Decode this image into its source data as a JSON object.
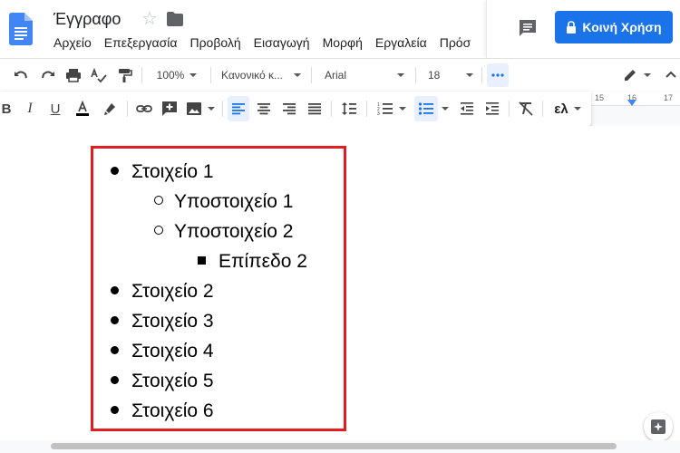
{
  "header": {
    "title": "Έγγραφο",
    "menu": [
      "Αρχείο",
      "Επεξεργασία",
      "Προβολή",
      "Εισαγωγή",
      "Μορφή",
      "Εργαλεία",
      "Πρόσ"
    ],
    "share_label": "Κοινή Χρήση"
  },
  "toolbar": {
    "zoom": "100%",
    "style": "Κανονικό κ...",
    "font": "Arial",
    "font_size": "18",
    "input_tools": "ελ"
  },
  "ruler": {
    "marks": [
      "15",
      "16",
      "17"
    ]
  },
  "document": {
    "list": [
      {
        "level": 1,
        "text": "Στοιχείο 1"
      },
      {
        "level": 2,
        "text": "Υποστοιχείο 1"
      },
      {
        "level": 2,
        "text": "Υποστοιχείο 2"
      },
      {
        "level": 3,
        "text": "Επίπεδο 2"
      },
      {
        "level": 1,
        "text": "Στοιχείο 2"
      },
      {
        "level": 1,
        "text": "Στοιχείο 3"
      },
      {
        "level": 1,
        "text": "Στοιχείο 4"
      },
      {
        "level": 1,
        "text": "Στοιχείο 5"
      },
      {
        "level": 1,
        "text": "Στοιχείο 6"
      }
    ]
  },
  "colors": {
    "accent": "#1a73e8",
    "highlight_box": "#e31b23"
  }
}
